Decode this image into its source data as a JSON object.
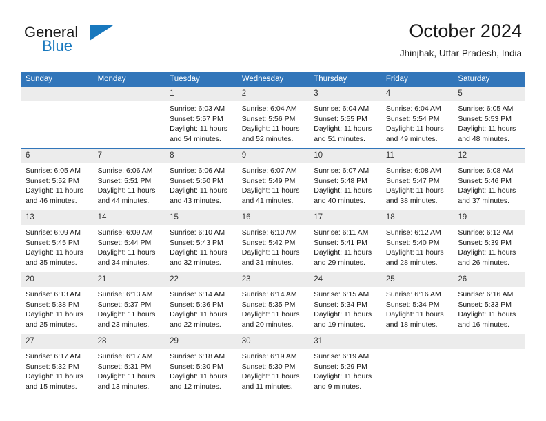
{
  "logo": {
    "name": "General Blue",
    "word_top": "General",
    "word_bottom": "Blue",
    "color": "#1878be"
  },
  "header": {
    "title": "October 2024",
    "subtitle": "Jhinjhak, Uttar Pradesh, India"
  },
  "theme": {
    "header_blue": "#3276ba",
    "daynum_gray": "#ececec",
    "text": "#1a1a1a"
  },
  "weekday_headers": [
    "Sunday",
    "Monday",
    "Tuesday",
    "Wednesday",
    "Thursday",
    "Friday",
    "Saturday"
  ],
  "weeks": [
    [
      {
        "day": "",
        "sunrise": "",
        "sunset": "",
        "daylight1": "",
        "daylight2": ""
      },
      {
        "day": "",
        "sunrise": "",
        "sunset": "",
        "daylight1": "",
        "daylight2": ""
      },
      {
        "day": "1",
        "sunrise": "Sunrise: 6:03 AM",
        "sunset": "Sunset: 5:57 PM",
        "daylight1": "Daylight: 11 hours",
        "daylight2": "and 54 minutes."
      },
      {
        "day": "2",
        "sunrise": "Sunrise: 6:04 AM",
        "sunset": "Sunset: 5:56 PM",
        "daylight1": "Daylight: 11 hours",
        "daylight2": "and 52 minutes."
      },
      {
        "day": "3",
        "sunrise": "Sunrise: 6:04 AM",
        "sunset": "Sunset: 5:55 PM",
        "daylight1": "Daylight: 11 hours",
        "daylight2": "and 51 minutes."
      },
      {
        "day": "4",
        "sunrise": "Sunrise: 6:04 AM",
        "sunset": "Sunset: 5:54 PM",
        "daylight1": "Daylight: 11 hours",
        "daylight2": "and 49 minutes."
      },
      {
        "day": "5",
        "sunrise": "Sunrise: 6:05 AM",
        "sunset": "Sunset: 5:53 PM",
        "daylight1": "Daylight: 11 hours",
        "daylight2": "and 48 minutes."
      }
    ],
    [
      {
        "day": "6",
        "sunrise": "Sunrise: 6:05 AM",
        "sunset": "Sunset: 5:52 PM",
        "daylight1": "Daylight: 11 hours",
        "daylight2": "and 46 minutes."
      },
      {
        "day": "7",
        "sunrise": "Sunrise: 6:06 AM",
        "sunset": "Sunset: 5:51 PM",
        "daylight1": "Daylight: 11 hours",
        "daylight2": "and 44 minutes."
      },
      {
        "day": "8",
        "sunrise": "Sunrise: 6:06 AM",
        "sunset": "Sunset: 5:50 PM",
        "daylight1": "Daylight: 11 hours",
        "daylight2": "and 43 minutes."
      },
      {
        "day": "9",
        "sunrise": "Sunrise: 6:07 AM",
        "sunset": "Sunset: 5:49 PM",
        "daylight1": "Daylight: 11 hours",
        "daylight2": "and 41 minutes."
      },
      {
        "day": "10",
        "sunrise": "Sunrise: 6:07 AM",
        "sunset": "Sunset: 5:48 PM",
        "daylight1": "Daylight: 11 hours",
        "daylight2": "and 40 minutes."
      },
      {
        "day": "11",
        "sunrise": "Sunrise: 6:08 AM",
        "sunset": "Sunset: 5:47 PM",
        "daylight1": "Daylight: 11 hours",
        "daylight2": "and 38 minutes."
      },
      {
        "day": "12",
        "sunrise": "Sunrise: 6:08 AM",
        "sunset": "Sunset: 5:46 PM",
        "daylight1": "Daylight: 11 hours",
        "daylight2": "and 37 minutes."
      }
    ],
    [
      {
        "day": "13",
        "sunrise": "Sunrise: 6:09 AM",
        "sunset": "Sunset: 5:45 PM",
        "daylight1": "Daylight: 11 hours",
        "daylight2": "and 35 minutes."
      },
      {
        "day": "14",
        "sunrise": "Sunrise: 6:09 AM",
        "sunset": "Sunset: 5:44 PM",
        "daylight1": "Daylight: 11 hours",
        "daylight2": "and 34 minutes."
      },
      {
        "day": "15",
        "sunrise": "Sunrise: 6:10 AM",
        "sunset": "Sunset: 5:43 PM",
        "daylight1": "Daylight: 11 hours",
        "daylight2": "and 32 minutes."
      },
      {
        "day": "16",
        "sunrise": "Sunrise: 6:10 AM",
        "sunset": "Sunset: 5:42 PM",
        "daylight1": "Daylight: 11 hours",
        "daylight2": "and 31 minutes."
      },
      {
        "day": "17",
        "sunrise": "Sunrise: 6:11 AM",
        "sunset": "Sunset: 5:41 PM",
        "daylight1": "Daylight: 11 hours",
        "daylight2": "and 29 minutes."
      },
      {
        "day": "18",
        "sunrise": "Sunrise: 6:12 AM",
        "sunset": "Sunset: 5:40 PM",
        "daylight1": "Daylight: 11 hours",
        "daylight2": "and 28 minutes."
      },
      {
        "day": "19",
        "sunrise": "Sunrise: 6:12 AM",
        "sunset": "Sunset: 5:39 PM",
        "daylight1": "Daylight: 11 hours",
        "daylight2": "and 26 minutes."
      }
    ],
    [
      {
        "day": "20",
        "sunrise": "Sunrise: 6:13 AM",
        "sunset": "Sunset: 5:38 PM",
        "daylight1": "Daylight: 11 hours",
        "daylight2": "and 25 minutes."
      },
      {
        "day": "21",
        "sunrise": "Sunrise: 6:13 AM",
        "sunset": "Sunset: 5:37 PM",
        "daylight1": "Daylight: 11 hours",
        "daylight2": "and 23 minutes."
      },
      {
        "day": "22",
        "sunrise": "Sunrise: 6:14 AM",
        "sunset": "Sunset: 5:36 PM",
        "daylight1": "Daylight: 11 hours",
        "daylight2": "and 22 minutes."
      },
      {
        "day": "23",
        "sunrise": "Sunrise: 6:14 AM",
        "sunset": "Sunset: 5:35 PM",
        "daylight1": "Daylight: 11 hours",
        "daylight2": "and 20 minutes."
      },
      {
        "day": "24",
        "sunrise": "Sunrise: 6:15 AM",
        "sunset": "Sunset: 5:34 PM",
        "daylight1": "Daylight: 11 hours",
        "daylight2": "and 19 minutes."
      },
      {
        "day": "25",
        "sunrise": "Sunrise: 6:16 AM",
        "sunset": "Sunset: 5:34 PM",
        "daylight1": "Daylight: 11 hours",
        "daylight2": "and 18 minutes."
      },
      {
        "day": "26",
        "sunrise": "Sunrise: 6:16 AM",
        "sunset": "Sunset: 5:33 PM",
        "daylight1": "Daylight: 11 hours",
        "daylight2": "and 16 minutes."
      }
    ],
    [
      {
        "day": "27",
        "sunrise": "Sunrise: 6:17 AM",
        "sunset": "Sunset: 5:32 PM",
        "daylight1": "Daylight: 11 hours",
        "daylight2": "and 15 minutes."
      },
      {
        "day": "28",
        "sunrise": "Sunrise: 6:17 AM",
        "sunset": "Sunset: 5:31 PM",
        "daylight1": "Daylight: 11 hours",
        "daylight2": "and 13 minutes."
      },
      {
        "day": "29",
        "sunrise": "Sunrise: 6:18 AM",
        "sunset": "Sunset: 5:30 PM",
        "daylight1": "Daylight: 11 hours",
        "daylight2": "and 12 minutes."
      },
      {
        "day": "30",
        "sunrise": "Sunrise: 6:19 AM",
        "sunset": "Sunset: 5:30 PM",
        "daylight1": "Daylight: 11 hours",
        "daylight2": "and 11 minutes."
      },
      {
        "day": "31",
        "sunrise": "Sunrise: 6:19 AM",
        "sunset": "Sunset: 5:29 PM",
        "daylight1": "Daylight: 11 hours",
        "daylight2": "and 9 minutes."
      },
      {
        "day": "",
        "sunrise": "",
        "sunset": "",
        "daylight1": "",
        "daylight2": ""
      },
      {
        "day": "",
        "sunrise": "",
        "sunset": "",
        "daylight1": "",
        "daylight2": ""
      }
    ]
  ]
}
